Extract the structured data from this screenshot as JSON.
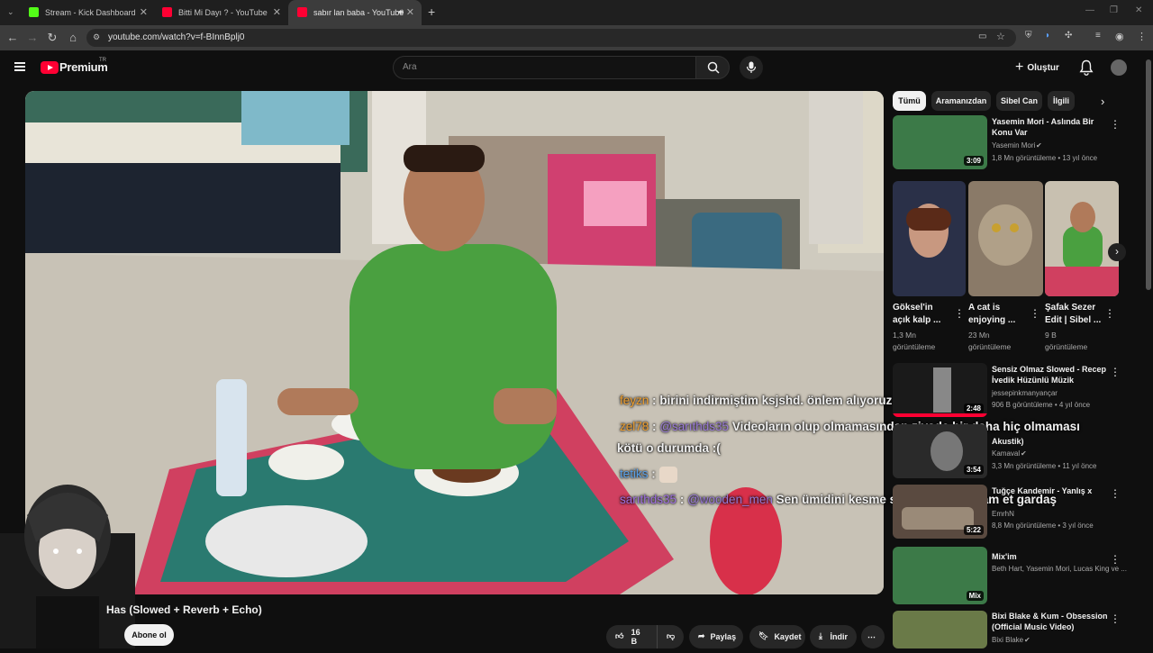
{
  "browser": {
    "tabs": [
      {
        "label": "Stream - Kick Dashboard",
        "color": "#53fc18"
      },
      {
        "label": "Bitti Mi Dayı ? - YouTube",
        "color": "#ff0033"
      },
      {
        "label": "sabır lan baba - YouTube",
        "color": "#ff0033"
      }
    ],
    "url": "youtube.com/watch?v=f-BInnBplj0"
  },
  "header": {
    "brand": "Premium",
    "region": "TR",
    "search_placeholder": "Ara",
    "create_label": "Oluştur"
  },
  "video": {
    "title": "Has (Slowed + Reverb + Echo)",
    "subscribe_label": "Abone ol",
    "likes": "16 B",
    "share_label": "Paylaş",
    "save_label": "Kaydet",
    "download_label": "İndir"
  },
  "chat": [
    {
      "user": "feyzn",
      "color": "#f0a030",
      "sep": ":",
      "text": "birini indirmiştim ksjshd. önlem alıyoruz"
    },
    {
      "user": "zel78",
      "color": "#f0a030",
      "sep": ":",
      "mention": "@sarıthds35",
      "text": "Videoların olup olmamasından ziyade bir daha hiç olmaması"
    },
    {
      "text": "kötü o durumda :("
    },
    {
      "user": "tetiks",
      "color": "#5aa0e8",
      "sep": ":"
    },
    {
      "user": "sarıthds35",
      "color": "#a070e0",
      "sep": ":",
      "mention": "@wooden_men",
      "text": "Sen ümidini kesme sa yazmaya devam et gardaş"
    }
  ],
  "chips": [
    "Tümü",
    "Aramanızdan",
    "Sibel Can",
    "İlgili"
  ],
  "sidebar": {
    "items": [
      {
        "title": "Yasemin Mori - Aslında Bir Konu Var",
        "channel": "Yasemin Mori",
        "meta": "1,8 Mn görüntüleme • 13 yıl önce",
        "duration": "3:09"
      },
      {
        "title": "Sensiz Olmaz Slowed - Recep İvedik Hüzünlü Müzik",
        "channel": "jessepinkmanyançar",
        "meta": "906 B görüntüleme • 4 yıl önce",
        "duration": "2:48"
      },
      {
        "title": "Akustik)",
        "channel": "Kamaval",
        "meta": "3,3 Mn görüntüleme • 11 yıl önce",
        "duration": "3:54"
      },
      {
        "title": "Tuğçe Kandemir - Yanlış x",
        "channel": "EmrhN",
        "meta": "8,8 Mn görüntüleme • 3 yıl önce",
        "duration": "5:22"
      },
      {
        "title": "Mix'im",
        "channel": "Beth Hart, Yasemin Mori, Lucas King ve ...",
        "meta": "",
        "duration": "Mix"
      },
      {
        "title": "Bixi Blake & Kum - Obsession (Official Music Video)",
        "channel": "Bixi Blake",
        "meta": "",
        "duration": ""
      }
    ],
    "shorts": [
      {
        "title": "Göksel'in açık kalp ...",
        "views": "1,3 Mn",
        "views_label": "görüntüleme"
      },
      {
        "title": "A cat is enjoying ...",
        "views": "23 Mn",
        "views_label": "görüntüleme"
      },
      {
        "title": "Şafak Sezer Edit | Sibel ...",
        "views": "9 B",
        "views_label": "görüntüleme"
      }
    ]
  }
}
